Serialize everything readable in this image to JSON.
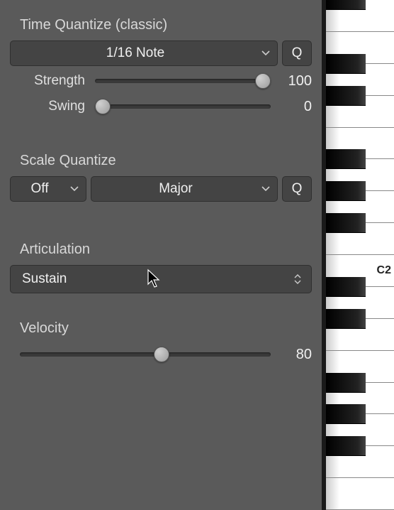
{
  "timeQuantize": {
    "title": "Time Quantize (classic)",
    "note": "1/16 Note",
    "q": "Q",
    "strength": {
      "label": "Strength",
      "value": 100,
      "pct": 100
    },
    "swing": {
      "label": "Swing",
      "value": 0,
      "pct": 0
    }
  },
  "scaleQuantize": {
    "title": "Scale Quantize",
    "mode": "Off",
    "scale": "Major",
    "q": "Q"
  },
  "articulation": {
    "title": "Articulation",
    "value": "Sustain"
  },
  "velocity": {
    "title": "Velocity",
    "value": 80,
    "pct": 57
  },
  "keyboard": {
    "labelNote": "C2"
  }
}
